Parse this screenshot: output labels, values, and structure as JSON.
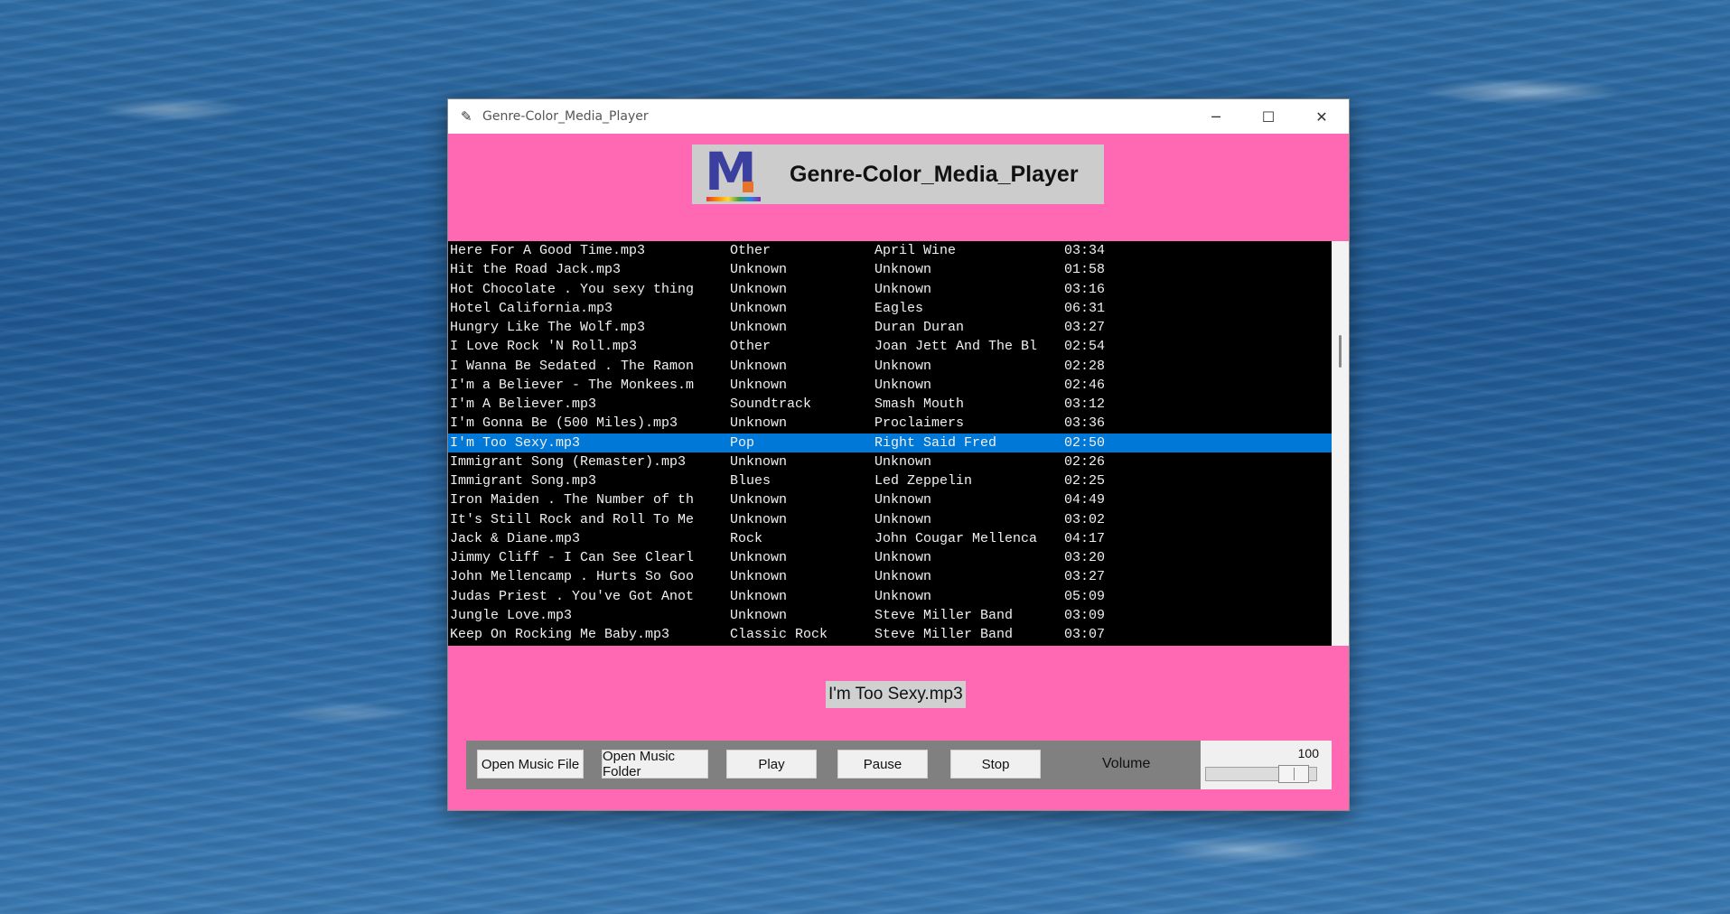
{
  "window": {
    "title": "Genre-Color_Media_Player",
    "controls": {
      "minimize": "─",
      "maximize": "☐",
      "close": "✕"
    }
  },
  "header": {
    "title": "Genre-Color_Media_Player",
    "logo_letter": "M"
  },
  "playlist": {
    "selected_index": 10,
    "rows": [
      {
        "file": "Here For A Good Time.mp3",
        "genre": "Other",
        "artist": "April Wine",
        "duration": "03:34"
      },
      {
        "file": "Hit the Road Jack.mp3",
        "genre": "Unknown",
        "artist": "Unknown",
        "duration": "01:58"
      },
      {
        "file": "Hot Chocolate . You sexy thing",
        "genre": "Unknown",
        "artist": "Unknown",
        "duration": "03:16"
      },
      {
        "file": "Hotel California.mp3",
        "genre": "Unknown",
        "artist": "Eagles",
        "duration": "06:31"
      },
      {
        "file": "Hungry Like The Wolf.mp3",
        "genre": "Unknown",
        "artist": "Duran Duran",
        "duration": "03:27"
      },
      {
        "file": "I Love Rock 'N Roll.mp3",
        "genre": "Other",
        "artist": "Joan Jett And The Bl",
        "duration": "02:54"
      },
      {
        "file": "I Wanna Be Sedated . The Ramon",
        "genre": "Unknown",
        "artist": "Unknown",
        "duration": "02:28"
      },
      {
        "file": "I'm a Believer - The Monkees.m",
        "genre": "Unknown",
        "artist": "Unknown",
        "duration": "02:46"
      },
      {
        "file": "I'm A Believer.mp3",
        "genre": "Soundtrack",
        "artist": "Smash Mouth",
        "duration": "03:12"
      },
      {
        "file": "I'm Gonna Be (500 Miles).mp3",
        "genre": "Unknown",
        "artist": "Proclaimers",
        "duration": "03:36"
      },
      {
        "file": "I'm Too Sexy.mp3",
        "genre": "Pop",
        "artist": "Right Said Fred",
        "duration": "02:50"
      },
      {
        "file": "Immigrant Song (Remaster).mp3",
        "genre": "Unknown",
        "artist": "Unknown",
        "duration": "02:26"
      },
      {
        "file": "Immigrant Song.mp3",
        "genre": "Blues",
        "artist": "Led Zeppelin",
        "duration": "02:25"
      },
      {
        "file": "Iron Maiden . The Number of th",
        "genre": "Unknown",
        "artist": "Unknown",
        "duration": "04:49"
      },
      {
        "file": "It's Still Rock and Roll To Me",
        "genre": "Unknown",
        "artist": "Unknown",
        "duration": "03:02"
      },
      {
        "file": "Jack & Diane.mp3",
        "genre": "Rock",
        "artist": "John Cougar Mellenca",
        "duration": "04:17"
      },
      {
        "file": "Jimmy Cliff - I Can See Clearl",
        "genre": "Unknown",
        "artist": "Unknown",
        "duration": "03:20"
      },
      {
        "file": "John Mellencamp . Hurts So Goo",
        "genre": "Unknown",
        "artist": "Unknown",
        "duration": "03:27"
      },
      {
        "file": "Judas Priest . You've Got Anot",
        "genre": "Unknown",
        "artist": "Unknown",
        "duration": "05:09"
      },
      {
        "file": "Jungle Love.mp3",
        "genre": "Unknown",
        "artist": "Steve Miller Band",
        "duration": "03:09"
      },
      {
        "file": "Keep On Rocking Me Baby.mp3",
        "genre": "Classic Rock",
        "artist": "Steve Miller Band",
        "duration": "03:07"
      }
    ]
  },
  "now_playing": "I'm Too Sexy.mp3",
  "controls": {
    "open_file": "Open Music File",
    "open_folder": "Open Music Folder",
    "play": "Play",
    "pause": "Pause",
    "stop": "Stop",
    "volume_label": "Volume",
    "volume_value": "100",
    "volume_fraction": 0.9
  },
  "colors": {
    "window_bg": "#ff69b4",
    "selection": "#0078d7",
    "list_bg": "#000000",
    "controls_bg": "#808080"
  }
}
